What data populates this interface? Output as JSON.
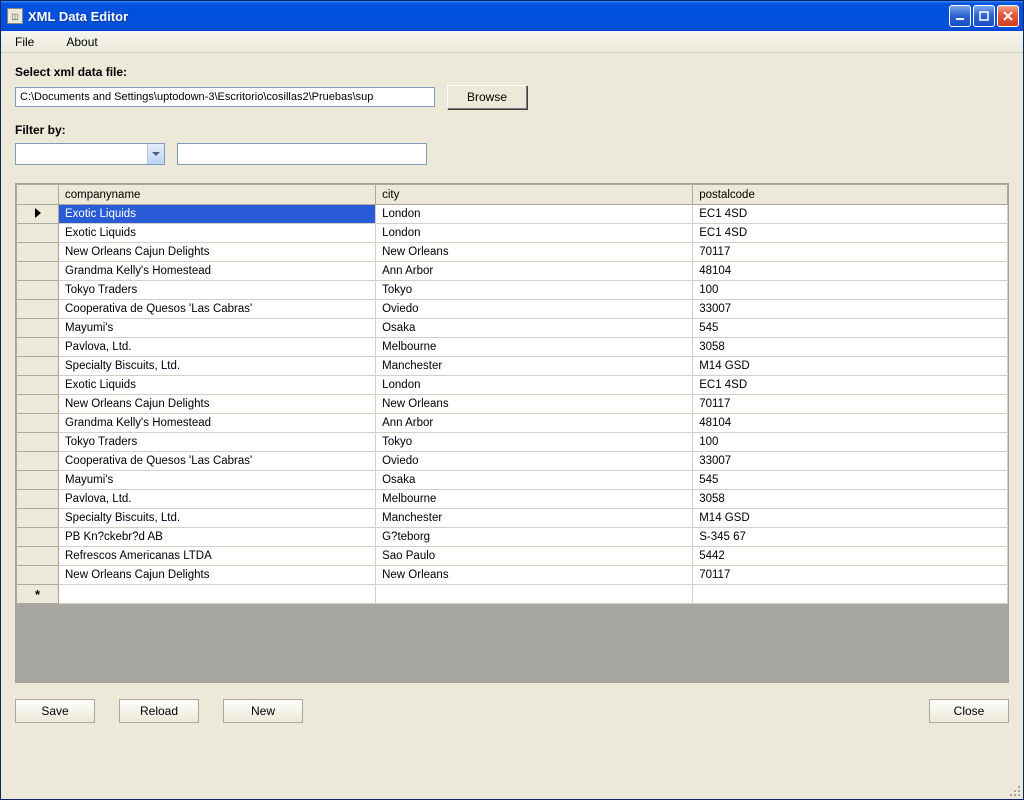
{
  "window": {
    "title": "XML Data Editor"
  },
  "menu": {
    "file": "File",
    "about": "About"
  },
  "labels": {
    "select_file": "Select xml data file:",
    "filter_by": "Filter by:"
  },
  "file": {
    "path": "C:\\Documents and Settings\\uptodown-3\\Escritorio\\cosillas2\\Pruebas\\sup",
    "browse": "Browse"
  },
  "filter": {
    "selected": "",
    "value": ""
  },
  "grid": {
    "columns": [
      "companyname",
      "city",
      "postalcode"
    ],
    "rows": [
      {
        "companyname": "Exotic Liquids",
        "city": "London",
        "postalcode": "EC1 4SD",
        "selected": true
      },
      {
        "companyname": "Exotic Liquids",
        "city": "London",
        "postalcode": "EC1 4SD"
      },
      {
        "companyname": "New Orleans Cajun Delights",
        "city": "New Orleans",
        "postalcode": "70117"
      },
      {
        "companyname": "Grandma Kelly's Homestead",
        "city": "Ann Arbor",
        "postalcode": "48104"
      },
      {
        "companyname": "Tokyo Traders",
        "city": "Tokyo",
        "postalcode": "100"
      },
      {
        "companyname": "Cooperativa de Quesos 'Las Cabras'",
        "city": "Oviedo",
        "postalcode": "33007"
      },
      {
        "companyname": "Mayumi's",
        "city": "Osaka",
        "postalcode": "545"
      },
      {
        "companyname": "Pavlova, Ltd.",
        "city": "Melbourne",
        "postalcode": "3058"
      },
      {
        "companyname": "Specialty Biscuits, Ltd.",
        "city": "Manchester",
        "postalcode": "M14 GSD"
      },
      {
        "companyname": "Exotic Liquids",
        "city": "London",
        "postalcode": "EC1 4SD"
      },
      {
        "companyname": "New Orleans Cajun Delights",
        "city": "New Orleans",
        "postalcode": "70117"
      },
      {
        "companyname": "Grandma Kelly's Homestead",
        "city": "Ann Arbor",
        "postalcode": "48104"
      },
      {
        "companyname": "Tokyo Traders",
        "city": "Tokyo",
        "postalcode": "100"
      },
      {
        "companyname": "Cooperativa de Quesos 'Las Cabras'",
        "city": "Oviedo",
        "postalcode": "33007"
      },
      {
        "companyname": "Mayumi's",
        "city": "Osaka",
        "postalcode": "545"
      },
      {
        "companyname": "Pavlova, Ltd.",
        "city": "Melbourne",
        "postalcode": "3058"
      },
      {
        "companyname": "Specialty Biscuits, Ltd.",
        "city": "Manchester",
        "postalcode": "M14 GSD"
      },
      {
        "companyname": "PB Kn?ckebr?d AB",
        "city": "G?teborg",
        "postalcode": "S-345 67"
      },
      {
        "companyname": "Refrescos Americanas LTDA",
        "city": "Sao Paulo",
        "postalcode": "5442"
      },
      {
        "companyname": "New Orleans Cajun Delights",
        "city": "New Orleans",
        "postalcode": "70117"
      }
    ]
  },
  "buttons": {
    "save": "Save",
    "reload": "Reload",
    "new": "New",
    "close": "Close"
  }
}
